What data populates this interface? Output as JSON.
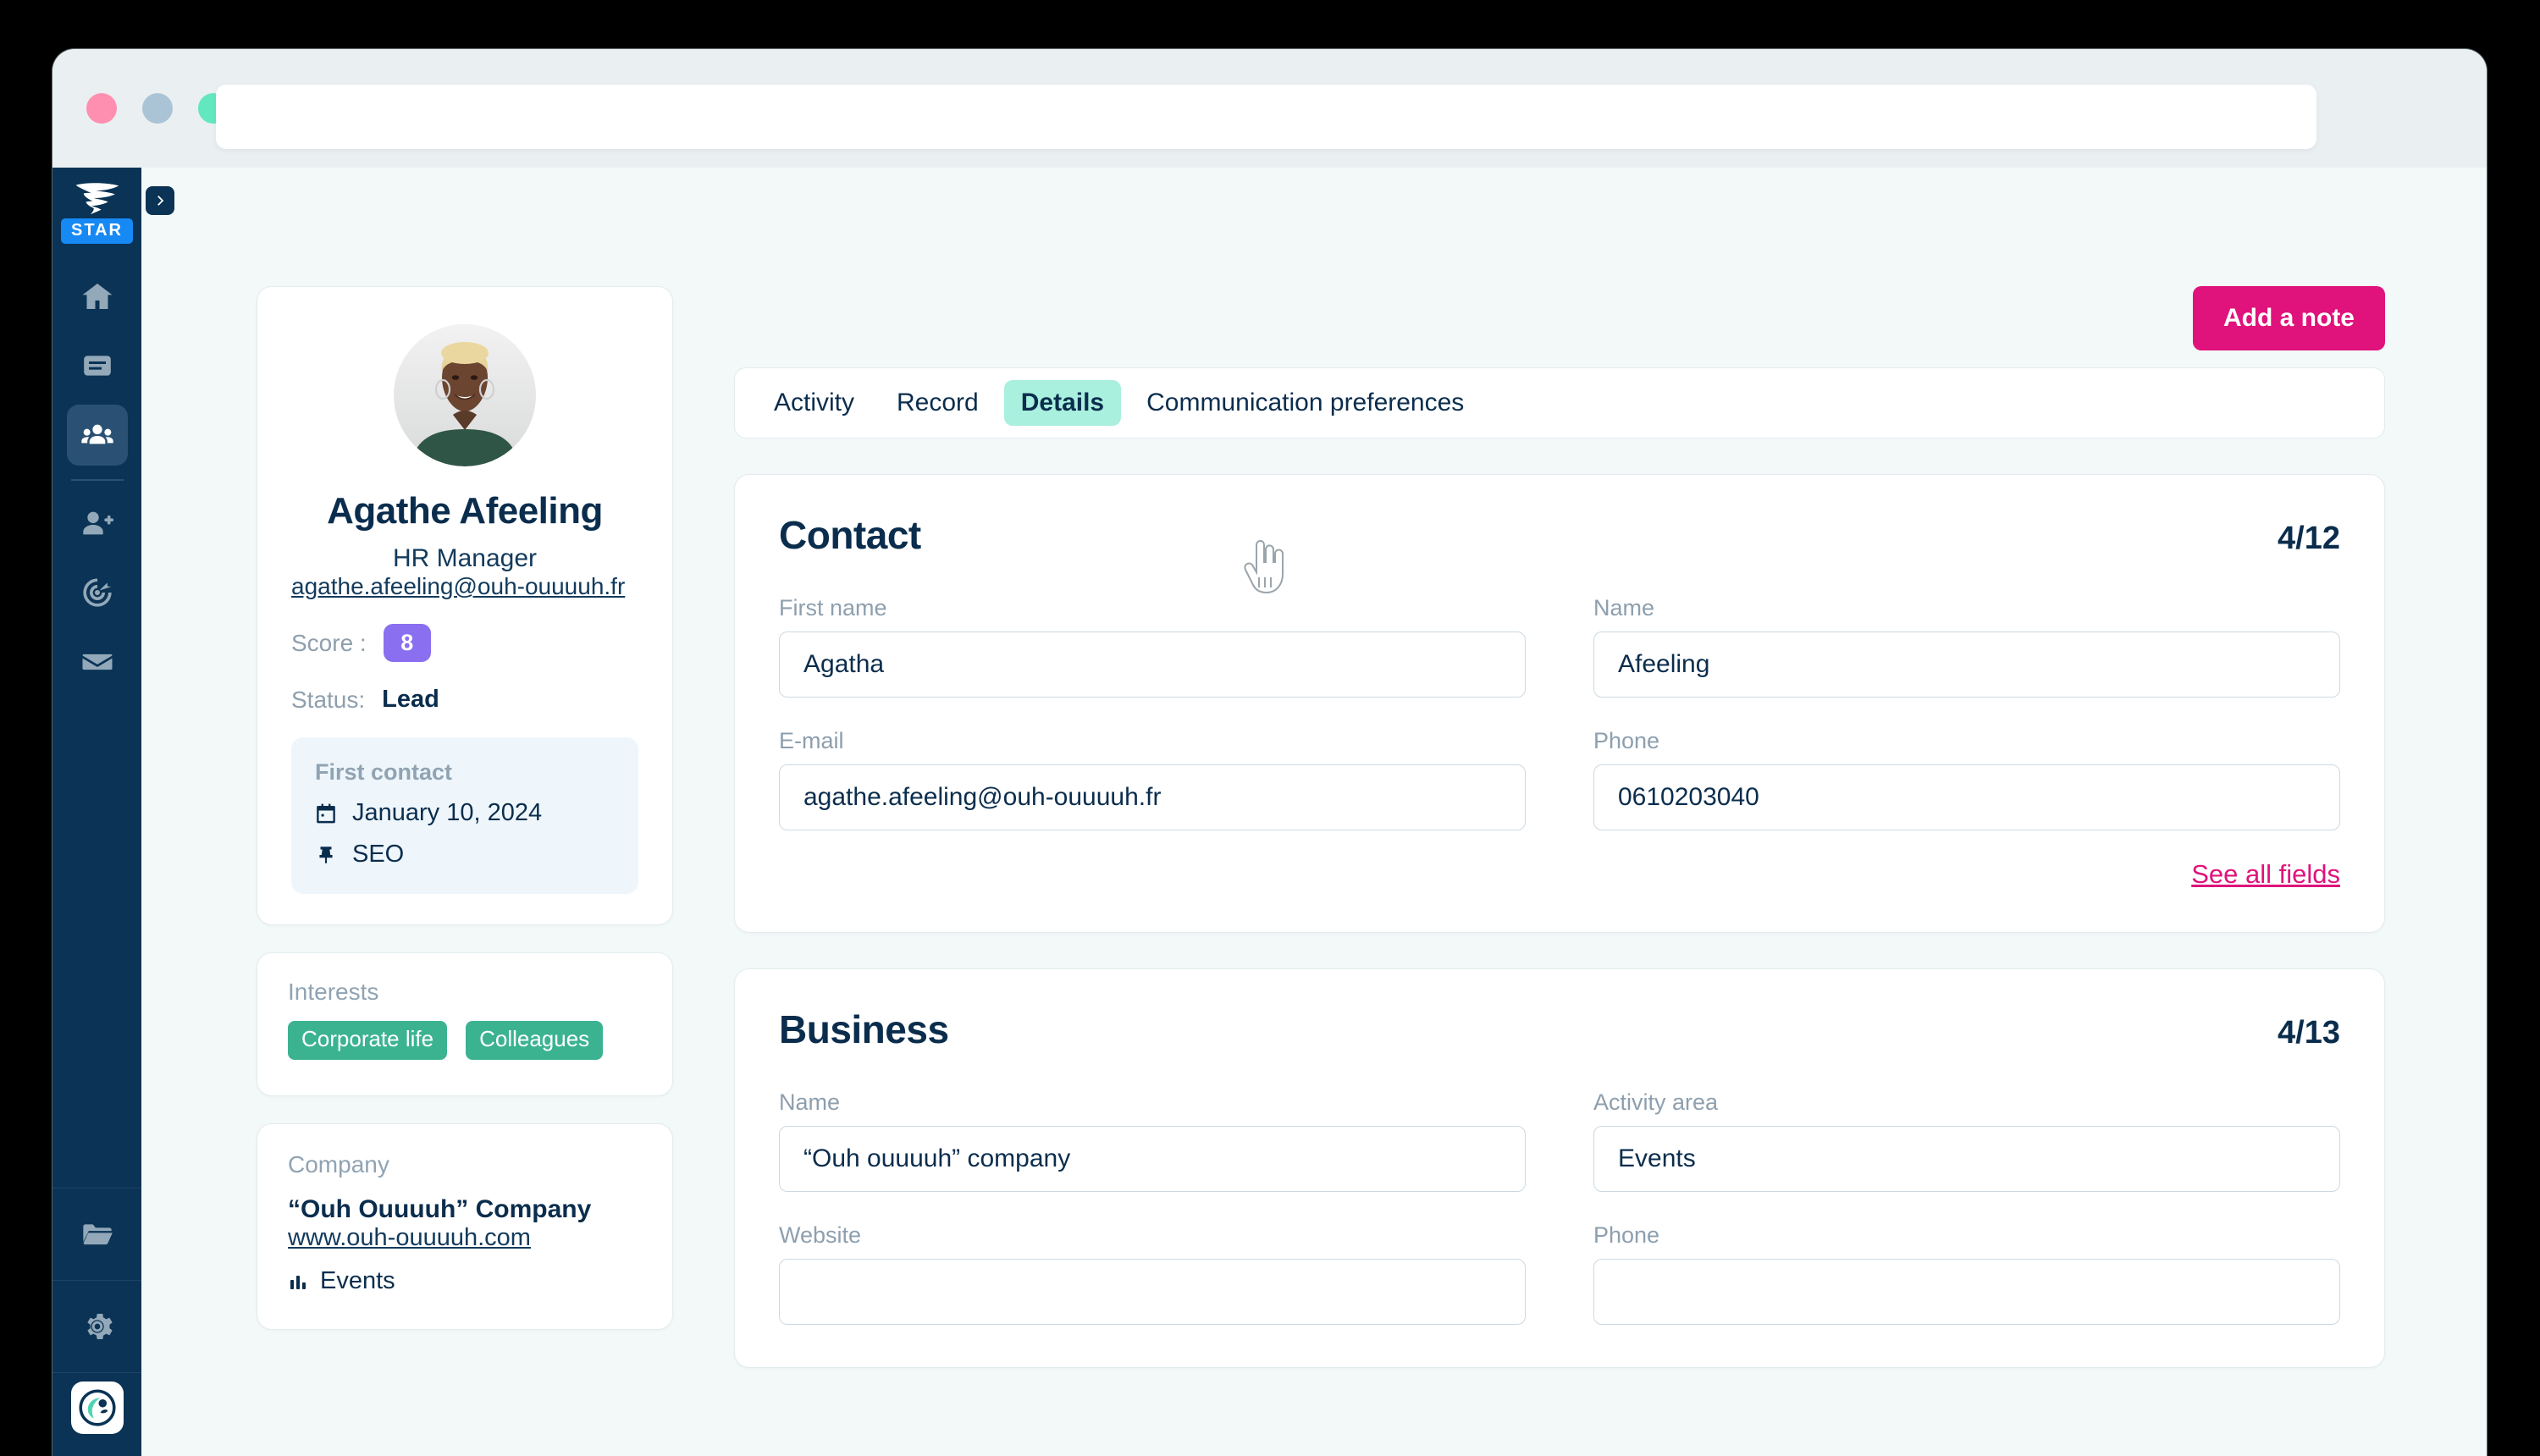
{
  "browser": {
    "traffic_lights": [
      "close",
      "minimize",
      "maximize"
    ],
    "url_value": "",
    "url_placeholder": ""
  },
  "sidebar": {
    "brand": {
      "logo_icon": "tornado-logo-icon",
      "badge": "STAR"
    },
    "collapse_icon": "chevron-right-icon",
    "items": [
      {
        "icon": "home-icon",
        "active": false
      },
      {
        "icon": "document-icon",
        "active": false
      },
      {
        "icon": "contacts-group-icon",
        "active": true
      },
      {
        "icon": "add-user-icon",
        "active": false
      },
      {
        "icon": "target-icon",
        "active": false
      },
      {
        "icon": "mail-icon",
        "active": false
      }
    ],
    "bottom_items": [
      {
        "icon": "folder-icon"
      },
      {
        "icon": "gear-icon"
      }
    ],
    "user_avatar_icon": "user-profile-logo-icon"
  },
  "profile": {
    "avatar_icon": "contact-photo",
    "name": "Agathe Afeeling",
    "role": "HR Manager",
    "email": "agathe.afeeling@ouh-ouuuuh.fr",
    "score_label": "Score :",
    "score_value": "8",
    "score_color": "#8a6ff0",
    "status_label": "Status:",
    "status_value": "Lead",
    "first_contact": {
      "title": "First contact",
      "date_icon": "calendar-icon",
      "date": "January 10, 2024",
      "source_icon": "pin-icon",
      "source": "SEO"
    }
  },
  "interests": {
    "label": "Interests",
    "tag_color": "#3bb391",
    "tags": [
      "Corporate life",
      "Colleagues"
    ]
  },
  "company": {
    "label": "Company",
    "name": "“Ouh Ouuuuh” Company",
    "website": "www.ouh-ouuuuh.com",
    "sector_icon": "chart-icon",
    "sector": "Events"
  },
  "main": {
    "add_note_label": "Add a note",
    "add_note_color": "#e0127b",
    "tabs": [
      {
        "label": "Activity",
        "active": false
      },
      {
        "label": "Record",
        "active": false
      },
      {
        "label": "Details",
        "active": true
      },
      {
        "label": "Communication preferences",
        "active": false
      }
    ],
    "active_tab_color": "#a9f0de",
    "sections": [
      {
        "title": "Contact",
        "count": "4/12",
        "fields": [
          {
            "label": "First name",
            "value": "Agatha",
            "placeholder": "First name"
          },
          {
            "label": "Name",
            "value": "Afeeling",
            "placeholder": "Name"
          },
          {
            "label": "E-mail",
            "value": "agathe.afeeling@ouh-ouuuuh.fr",
            "placeholder": "E-mail"
          },
          {
            "label": "Phone",
            "value": "0610203040",
            "placeholder": "Phone"
          }
        ],
        "see_all_label": "See all fields"
      },
      {
        "title": "Business",
        "count": "4/13",
        "fields": [
          {
            "label": "Name",
            "value": "“Ouh ouuuuh” company",
            "placeholder": "Name"
          },
          {
            "label": "Activity area",
            "value": "Events",
            "placeholder": "Activity area"
          },
          {
            "label": "Website",
            "value": "",
            "placeholder": "Website"
          },
          {
            "label": "Phone",
            "value": "",
            "placeholder": "Phone"
          }
        ]
      }
    ]
  },
  "cursor": {
    "icon": "pointing-hand-cursor"
  }
}
